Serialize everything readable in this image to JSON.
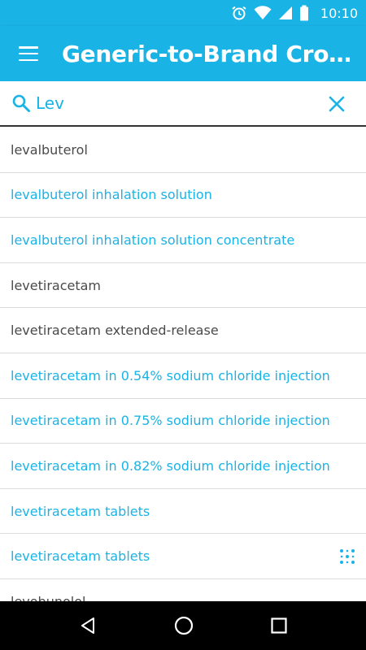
{
  "status_bar": {
    "time": "10:10"
  },
  "app_bar": {
    "title": "Generic-to-Brand Cros…"
  },
  "search": {
    "value": "Lev"
  },
  "results": [
    {
      "label": "levalbuterol",
      "style": "plain"
    },
    {
      "label": "levalbuterol inhalation solution",
      "style": "link"
    },
    {
      "label": "levalbuterol inhalation solution concentrate",
      "style": "link"
    },
    {
      "label": "levetiracetam",
      "style": "plain"
    },
    {
      "label": "levetiracetam extended-release",
      "style": "plain"
    },
    {
      "label": "levetiracetam in 0.54% sodium chloride injection",
      "style": "link"
    },
    {
      "label": "levetiracetam in 0.75% sodium chloride injection",
      "style": "link"
    },
    {
      "label": "levetiracetam in 0.82% sodium chloride injection",
      "style": "link"
    },
    {
      "label": "levetiracetam tablets",
      "style": "link"
    },
    {
      "label": "levetiracetam tablets",
      "style": "link",
      "badge": "dots-grid-icon"
    },
    {
      "label": "levobunolol",
      "style": "plain"
    }
  ],
  "colors": {
    "accent": "#1ab3e6",
    "plain_text": "#4a4a4a",
    "divider": "#dcdcdc"
  }
}
